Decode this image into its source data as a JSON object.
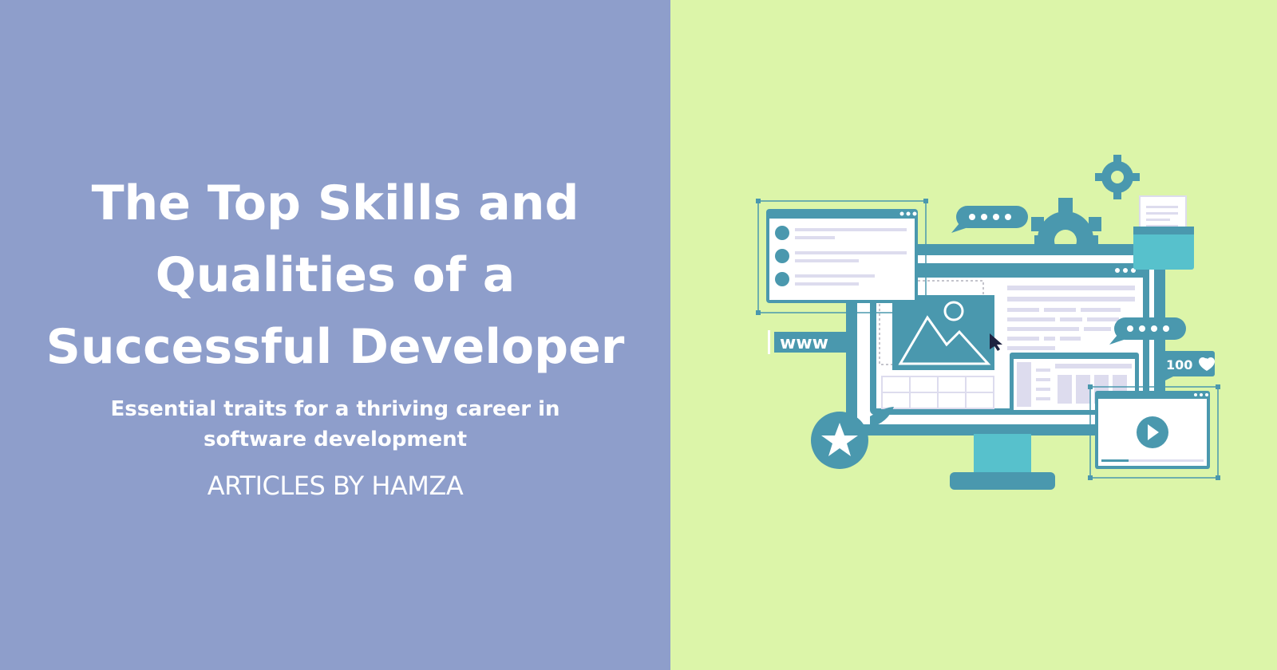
{
  "banner": {
    "title": "The Top Skills and Qualities of a Successful Developer",
    "subtitle": "Essential traits for a thriving career in software development",
    "byline": "ARTICLES BY HAMZA"
  },
  "illustration": {
    "url_label": "www",
    "likes_label": "100",
    "icons": [
      "gear-icon",
      "chat-bubble-icon",
      "folder-icon",
      "document-icon",
      "image-icon",
      "cursor-icon",
      "star-icon",
      "play-icon",
      "heart-icon",
      "monitor-icon"
    ]
  },
  "colors": {
    "left_background": "#8e9ecb",
    "right_background": "#dcf5a9",
    "teal_dark": "#4a98ae",
    "teal_light": "#57c1cc",
    "text": "#ffffff"
  }
}
